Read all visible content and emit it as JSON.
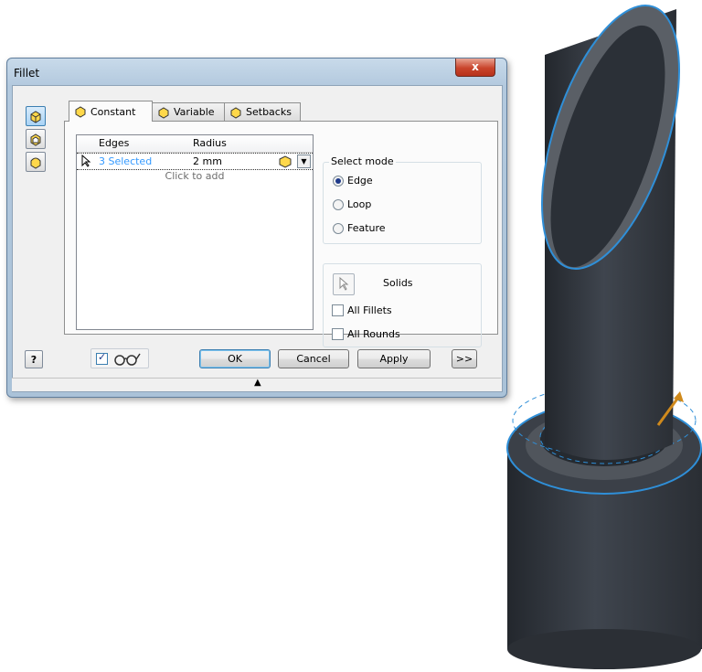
{
  "dialog": {
    "title": "Fillet",
    "close_label": "x",
    "tabs": [
      {
        "label": "Constant"
      },
      {
        "label": "Variable"
      },
      {
        "label": "Setbacks"
      }
    ],
    "table": {
      "headers": [
        "Edges",
        "Radius"
      ],
      "rows": [
        {
          "edges": "3 Selected",
          "radius": "2 mm"
        }
      ],
      "add_prompt": "Click to add"
    },
    "select_mode": {
      "label": "Select mode",
      "options": [
        "Edge",
        "Loop",
        "Feature"
      ],
      "selected": "Edge"
    },
    "solids_label": "Solids",
    "checkboxes": [
      {
        "label": "All Fillets",
        "checked": false
      },
      {
        "label": "All Rounds",
        "checked": false
      }
    ],
    "preview_checked": true,
    "buttons": {
      "ok": "OK",
      "cancel": "Cancel",
      "apply": "Apply",
      "more": ">>"
    },
    "help_label": "?",
    "collapse_glyph": "▲"
  },
  "icons": [
    "fillet-edge-icon",
    "face-fillet-icon",
    "full-round-icon",
    "select-arrow-icon",
    "help-icon",
    "glasses-icon",
    "dropdown-arrow-icon"
  ],
  "colors": {
    "accent_blue": "#2f8fd8",
    "selected_text": "#3399ff",
    "model_dark": "#353a42",
    "arrow_orange": "#d08a1c"
  }
}
